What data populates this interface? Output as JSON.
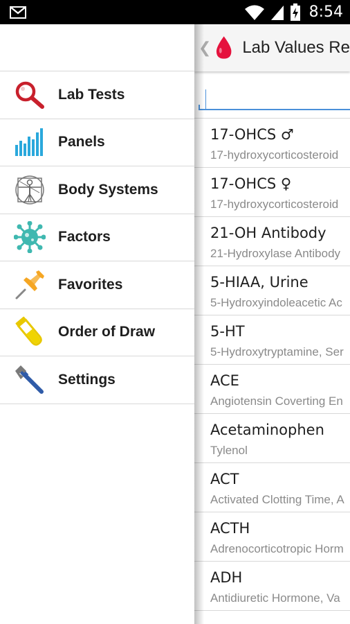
{
  "status_bar": {
    "time": "8:54"
  },
  "drawer": {
    "items": [
      {
        "label": "Lab Tests",
        "icon": "magnifier-icon"
      },
      {
        "label": "Panels",
        "icon": "bar-chart-icon"
      },
      {
        "label": "Body Systems",
        "icon": "vitruvian-man-icon"
      },
      {
        "label": "Factors",
        "icon": "virus-icon"
      },
      {
        "label": "Favorites",
        "icon": "pushpin-icon"
      },
      {
        "label": "Order of Draw",
        "icon": "test-tube-icon"
      },
      {
        "label": "Settings",
        "icon": "wrench-icon"
      }
    ]
  },
  "action_bar": {
    "back_glyph": "❮",
    "title": "Lab Values Re"
  },
  "search": {
    "value": "",
    "placeholder": ""
  },
  "tests": [
    {
      "name": "17-OHCS ♂",
      "desc": "17-hydroxycorticosteroid"
    },
    {
      "name": "17-OHCS ♀",
      "desc": "17-hydroxycorticosteroid"
    },
    {
      "name": "21-OH Antibody",
      "desc": "21-Hydroxylase Antibody"
    },
    {
      "name": "5-HIAA, Urine",
      "desc": "5-Hydroxyindoleacetic Ac"
    },
    {
      "name": "5-HT",
      "desc": "5-Hydroxytryptamine, Ser"
    },
    {
      "name": "ACE",
      "desc": "Angiotensin Coverting En"
    },
    {
      "name": "Acetaminophen",
      "desc": "Tylenol"
    },
    {
      "name": "ACT",
      "desc": "Activated Clotting Time, A"
    },
    {
      "name": "ACTH",
      "desc": "Adrenocorticotropic Horm"
    },
    {
      "name": "ADH",
      "desc": "Antidiuretic Hormone, Va"
    }
  ],
  "colors": {
    "accent": "#4a90d9",
    "drop_red": "#e5123d"
  }
}
